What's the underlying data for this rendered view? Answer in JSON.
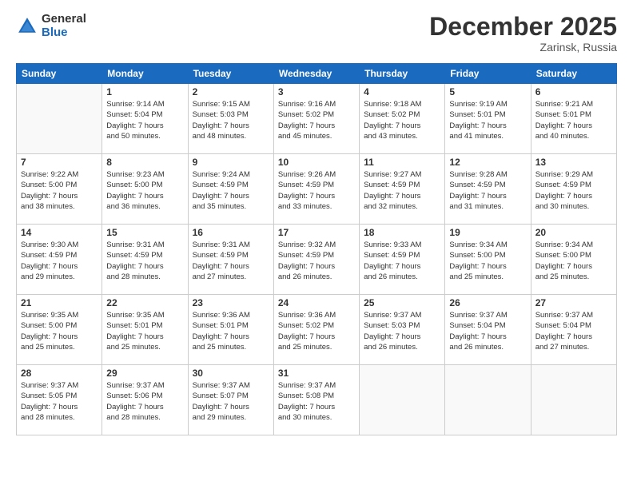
{
  "logo": {
    "general": "General",
    "blue": "Blue"
  },
  "title": "December 2025",
  "subtitle": "Zarinsk, Russia",
  "days_of_week": [
    "Sunday",
    "Monday",
    "Tuesday",
    "Wednesday",
    "Thursday",
    "Friday",
    "Saturday"
  ],
  "weeks": [
    [
      {
        "day": "",
        "sunrise": "",
        "sunset": "",
        "daylight": ""
      },
      {
        "day": "1",
        "sunrise": "Sunrise: 9:14 AM",
        "sunset": "Sunset: 5:04 PM",
        "daylight": "Daylight: 7 hours and 50 minutes."
      },
      {
        "day": "2",
        "sunrise": "Sunrise: 9:15 AM",
        "sunset": "Sunset: 5:03 PM",
        "daylight": "Daylight: 7 hours and 48 minutes."
      },
      {
        "day": "3",
        "sunrise": "Sunrise: 9:16 AM",
        "sunset": "Sunset: 5:02 PM",
        "daylight": "Daylight: 7 hours and 45 minutes."
      },
      {
        "day": "4",
        "sunrise": "Sunrise: 9:18 AM",
        "sunset": "Sunset: 5:02 PM",
        "daylight": "Daylight: 7 hours and 43 minutes."
      },
      {
        "day": "5",
        "sunrise": "Sunrise: 9:19 AM",
        "sunset": "Sunset: 5:01 PM",
        "daylight": "Daylight: 7 hours and 41 minutes."
      },
      {
        "day": "6",
        "sunrise": "Sunrise: 9:21 AM",
        "sunset": "Sunset: 5:01 PM",
        "daylight": "Daylight: 7 hours and 40 minutes."
      }
    ],
    [
      {
        "day": "7",
        "sunrise": "Sunrise: 9:22 AM",
        "sunset": "Sunset: 5:00 PM",
        "daylight": "Daylight: 7 hours and 38 minutes."
      },
      {
        "day": "8",
        "sunrise": "Sunrise: 9:23 AM",
        "sunset": "Sunset: 5:00 PM",
        "daylight": "Daylight: 7 hours and 36 minutes."
      },
      {
        "day": "9",
        "sunrise": "Sunrise: 9:24 AM",
        "sunset": "Sunset: 4:59 PM",
        "daylight": "Daylight: 7 hours and 35 minutes."
      },
      {
        "day": "10",
        "sunrise": "Sunrise: 9:26 AM",
        "sunset": "Sunset: 4:59 PM",
        "daylight": "Daylight: 7 hours and 33 minutes."
      },
      {
        "day": "11",
        "sunrise": "Sunrise: 9:27 AM",
        "sunset": "Sunset: 4:59 PM",
        "daylight": "Daylight: 7 hours and 32 minutes."
      },
      {
        "day": "12",
        "sunrise": "Sunrise: 9:28 AM",
        "sunset": "Sunset: 4:59 PM",
        "daylight": "Daylight: 7 hours and 31 minutes."
      },
      {
        "day": "13",
        "sunrise": "Sunrise: 9:29 AM",
        "sunset": "Sunset: 4:59 PM",
        "daylight": "Daylight: 7 hours and 30 minutes."
      }
    ],
    [
      {
        "day": "14",
        "sunrise": "Sunrise: 9:30 AM",
        "sunset": "Sunset: 4:59 PM",
        "daylight": "Daylight: 7 hours and 29 minutes."
      },
      {
        "day": "15",
        "sunrise": "Sunrise: 9:31 AM",
        "sunset": "Sunset: 4:59 PM",
        "daylight": "Daylight: 7 hours and 28 minutes."
      },
      {
        "day": "16",
        "sunrise": "Sunrise: 9:31 AM",
        "sunset": "Sunset: 4:59 PM",
        "daylight": "Daylight: 7 hours and 27 minutes."
      },
      {
        "day": "17",
        "sunrise": "Sunrise: 9:32 AM",
        "sunset": "Sunset: 4:59 PM",
        "daylight": "Daylight: 7 hours and 26 minutes."
      },
      {
        "day": "18",
        "sunrise": "Sunrise: 9:33 AM",
        "sunset": "Sunset: 4:59 PM",
        "daylight": "Daylight: 7 hours and 26 minutes."
      },
      {
        "day": "19",
        "sunrise": "Sunrise: 9:34 AM",
        "sunset": "Sunset: 5:00 PM",
        "daylight": "Daylight: 7 hours and 25 minutes."
      },
      {
        "day": "20",
        "sunrise": "Sunrise: 9:34 AM",
        "sunset": "Sunset: 5:00 PM",
        "daylight": "Daylight: 7 hours and 25 minutes."
      }
    ],
    [
      {
        "day": "21",
        "sunrise": "Sunrise: 9:35 AM",
        "sunset": "Sunset: 5:00 PM",
        "daylight": "Daylight: 7 hours and 25 minutes."
      },
      {
        "day": "22",
        "sunrise": "Sunrise: 9:35 AM",
        "sunset": "Sunset: 5:01 PM",
        "daylight": "Daylight: 7 hours and 25 minutes."
      },
      {
        "day": "23",
        "sunrise": "Sunrise: 9:36 AM",
        "sunset": "Sunset: 5:01 PM",
        "daylight": "Daylight: 7 hours and 25 minutes."
      },
      {
        "day": "24",
        "sunrise": "Sunrise: 9:36 AM",
        "sunset": "Sunset: 5:02 PM",
        "daylight": "Daylight: 7 hours and 25 minutes."
      },
      {
        "day": "25",
        "sunrise": "Sunrise: 9:37 AM",
        "sunset": "Sunset: 5:03 PM",
        "daylight": "Daylight: 7 hours and 26 minutes."
      },
      {
        "day": "26",
        "sunrise": "Sunrise: 9:37 AM",
        "sunset": "Sunset: 5:04 PM",
        "daylight": "Daylight: 7 hours and 26 minutes."
      },
      {
        "day": "27",
        "sunrise": "Sunrise: 9:37 AM",
        "sunset": "Sunset: 5:04 PM",
        "daylight": "Daylight: 7 hours and 27 minutes."
      }
    ],
    [
      {
        "day": "28",
        "sunrise": "Sunrise: 9:37 AM",
        "sunset": "Sunset: 5:05 PM",
        "daylight": "Daylight: 7 hours and 28 minutes."
      },
      {
        "day": "29",
        "sunrise": "Sunrise: 9:37 AM",
        "sunset": "Sunset: 5:06 PM",
        "daylight": "Daylight: 7 hours and 28 minutes."
      },
      {
        "day": "30",
        "sunrise": "Sunrise: 9:37 AM",
        "sunset": "Sunset: 5:07 PM",
        "daylight": "Daylight: 7 hours and 29 minutes."
      },
      {
        "day": "31",
        "sunrise": "Sunrise: 9:37 AM",
        "sunset": "Sunset: 5:08 PM",
        "daylight": "Daylight: 7 hours and 30 minutes."
      },
      {
        "day": "",
        "sunrise": "",
        "sunset": "",
        "daylight": ""
      },
      {
        "day": "",
        "sunrise": "",
        "sunset": "",
        "daylight": ""
      },
      {
        "day": "",
        "sunrise": "",
        "sunset": "",
        "daylight": ""
      }
    ]
  ]
}
